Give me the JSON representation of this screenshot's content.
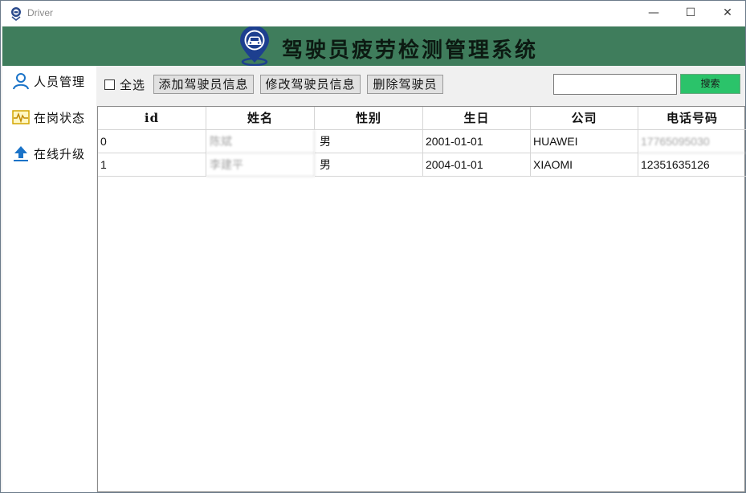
{
  "window": {
    "title": "Driver",
    "min_glyph": "—",
    "max_glyph": "☐",
    "close_glyph": "✕"
  },
  "banner": {
    "title": "驾驶员疲劳检测管理系统",
    "icon": "car-location-pin-icon"
  },
  "sidebar": {
    "items": [
      {
        "label": "人员管理",
        "icon": "person-icon"
      },
      {
        "label": "在岗状态",
        "icon": "pulse-monitor-icon"
      },
      {
        "label": "在线升级",
        "icon": "upload-arrow-icon"
      }
    ]
  },
  "toolbar": {
    "select_all_label": "全选",
    "add_label": "添加驾驶员信息",
    "edit_label": "修改驾驶员信息",
    "delete_label": "删除驾驶员",
    "search_value": "",
    "search_label": "搜索"
  },
  "table": {
    "columns": [
      "id",
      "姓名",
      "性别",
      "生日",
      "公司",
      "电话号码"
    ],
    "rows": [
      [
        "0",
        "陈斌",
        "男",
        "2001-01-01",
        "HUAWEI",
        "17765095030"
      ],
      [
        "1",
        "李建平",
        "男",
        "2004-01-01",
        "XIAOMI",
        "12351635126"
      ]
    ]
  },
  "colors": {
    "banner": "#3f7d5c",
    "search_button": "#2bc36a",
    "accent_icon": "#1a73c8"
  }
}
